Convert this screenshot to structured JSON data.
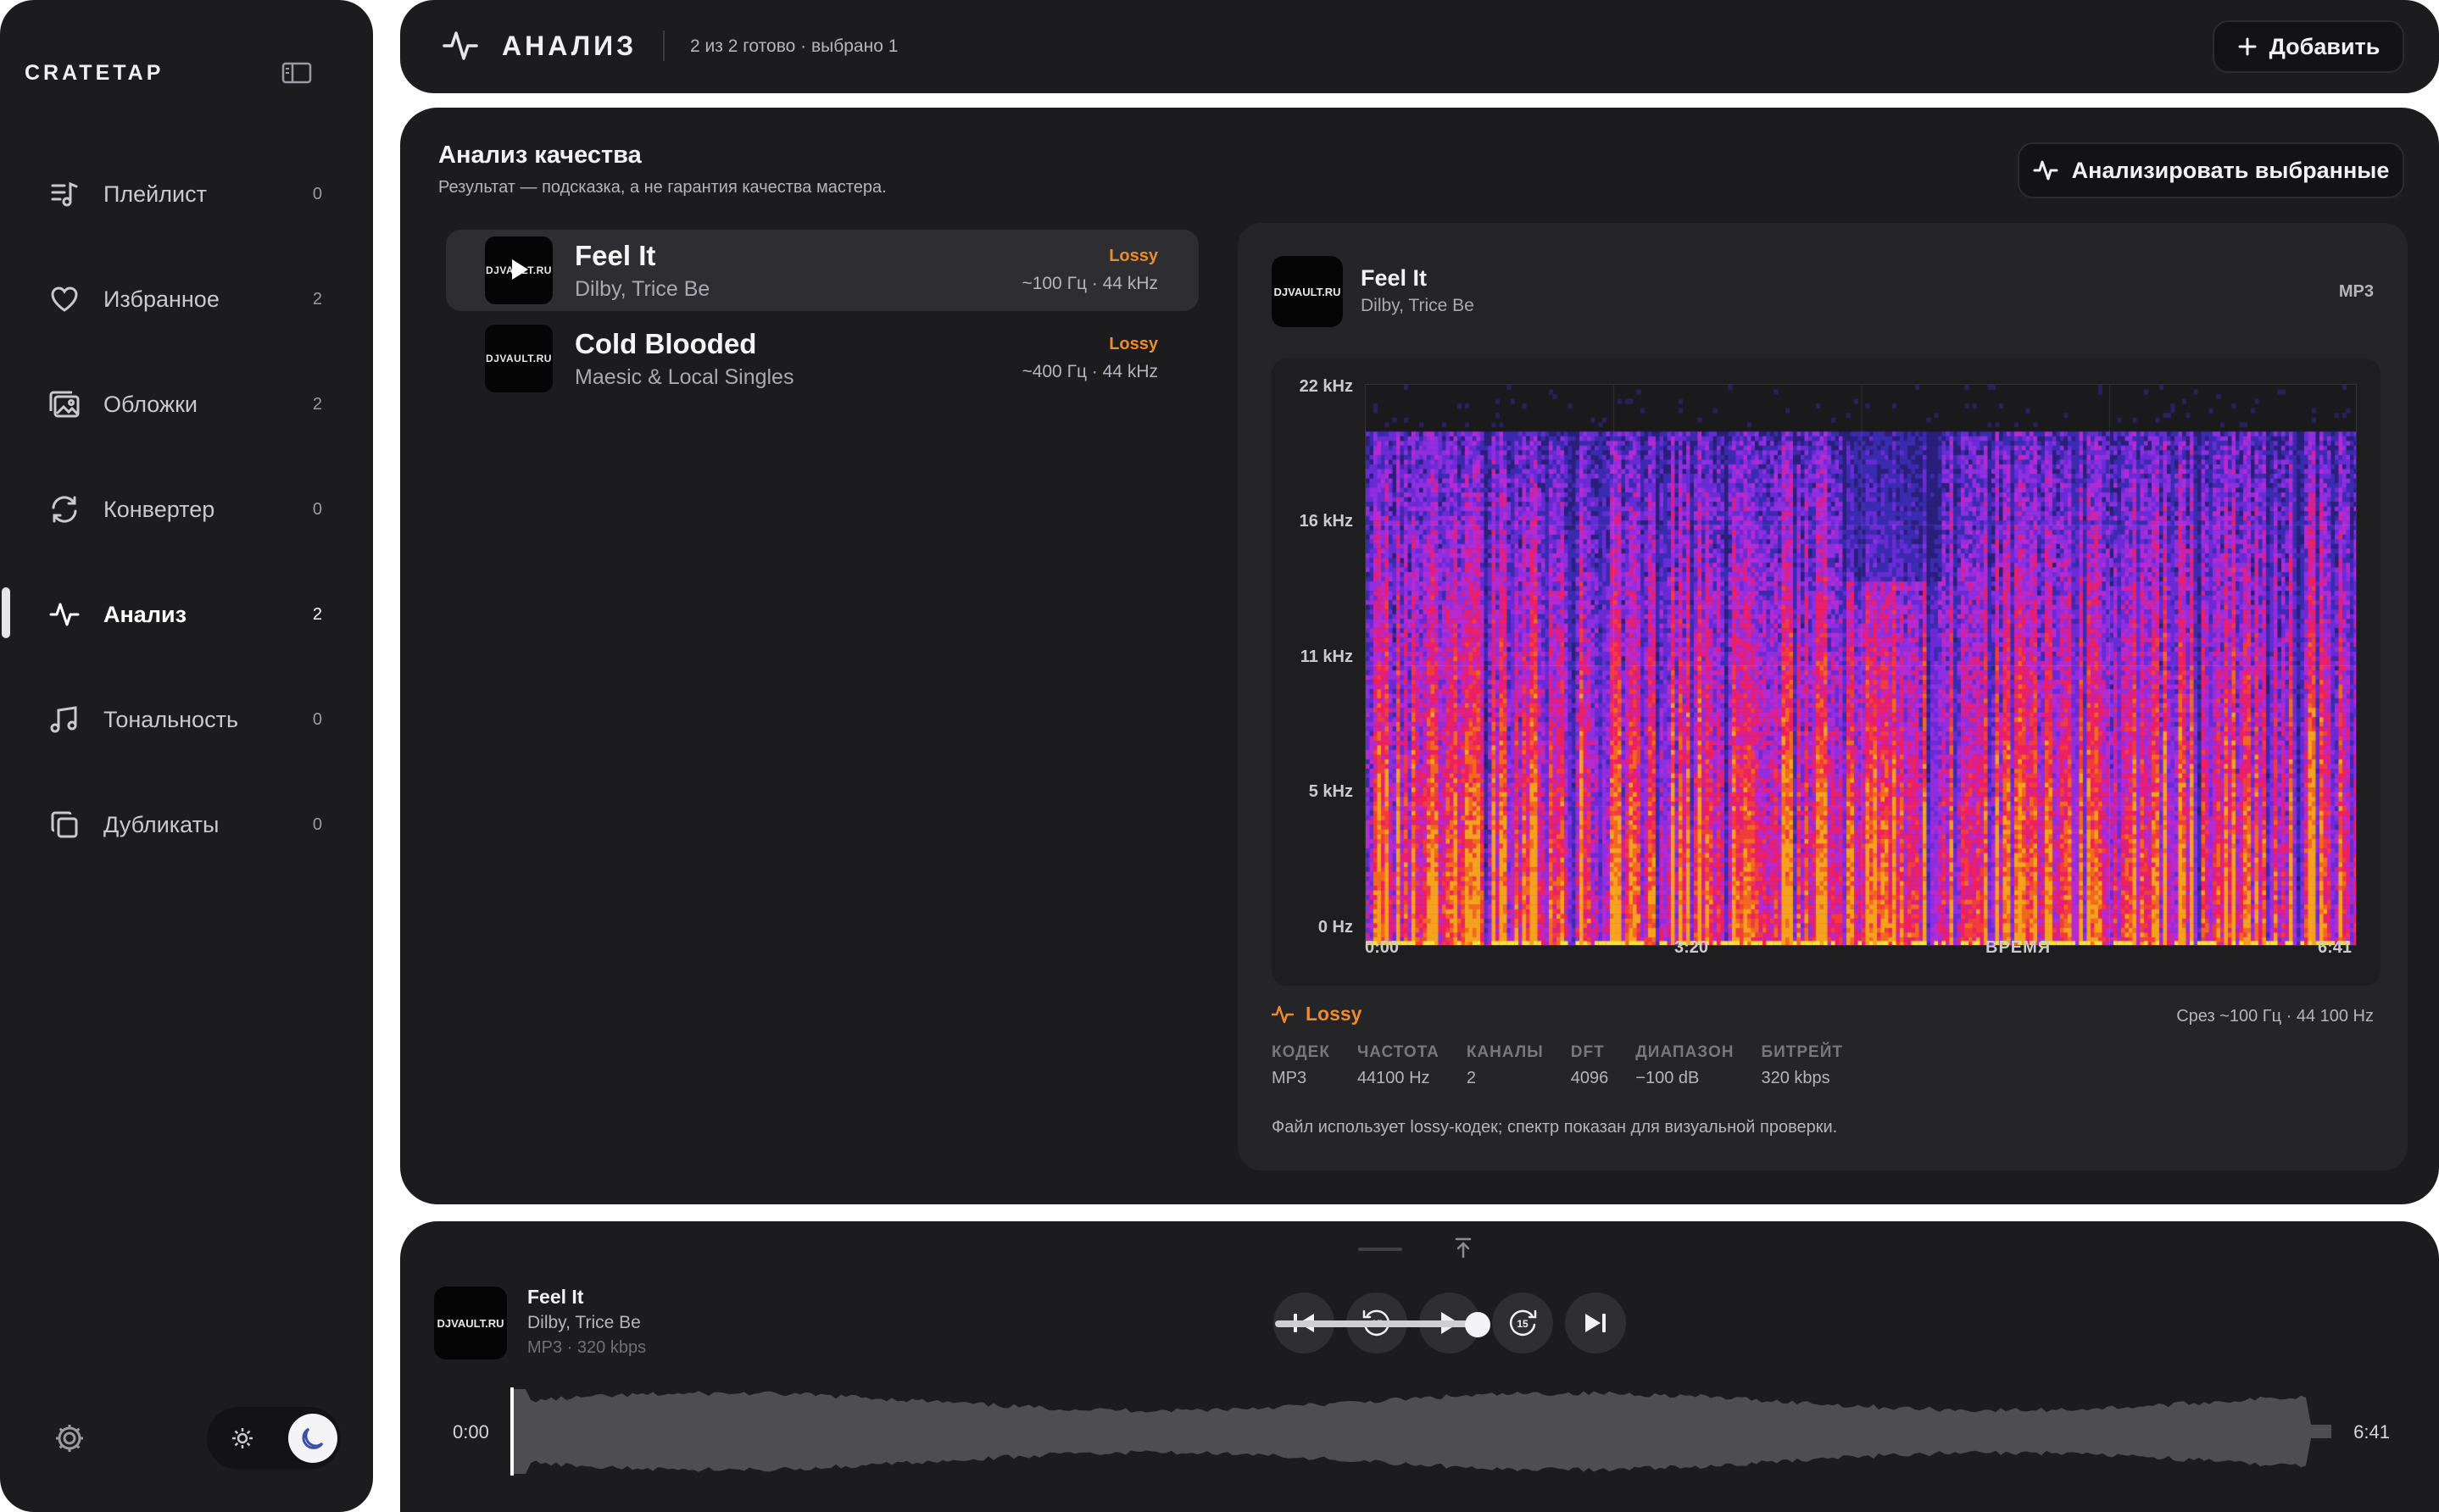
{
  "sidebar": {
    "brand": "CRATETAP",
    "nav": [
      {
        "label": "Плейлист",
        "count": "0",
        "icon": "playlist-icon"
      },
      {
        "label": "Избранное",
        "count": "2",
        "icon": "heart-icon"
      },
      {
        "label": "Обложки",
        "count": "2",
        "icon": "images-icon"
      },
      {
        "label": "Конвертер",
        "count": "0",
        "icon": "convert-icon"
      },
      {
        "label": "Анализ",
        "count": "2",
        "icon": "pulse-icon",
        "active": true
      },
      {
        "label": "Тональность",
        "count": "0",
        "icon": "music-notes-icon"
      },
      {
        "label": "Дубликаты",
        "count": "0",
        "icon": "copy-icon"
      }
    ],
    "theme": "dark"
  },
  "header": {
    "title": "АНАЛИЗ",
    "status": "2 из 2 готово · выбрано 1",
    "add_label": "Добавить"
  },
  "main": {
    "title": "Анализ качества",
    "subtitle": "Результат — подсказка, а не гарантия качества мастера.",
    "analyze_label": "Анализировать выбранные",
    "tracks": [
      {
        "name": "Feel It",
        "artist": "Dilby, Trice Be",
        "badge": "Lossy",
        "meta": "~100 Гц · 44 kHz",
        "cover": "DJVAULT.RU",
        "selected": true
      },
      {
        "name": "Cold Blooded",
        "artist": "Maesic & Local Singles",
        "badge": "Lossy",
        "meta": "~400 Гц · 44 kHz",
        "cover": "DJVAULT.RU",
        "selected": false
      }
    ]
  },
  "analysis": {
    "cover": "DJVAULT.RU",
    "title": "Feel It",
    "artist": "Dilby, Trice Be",
    "format": "MP3",
    "y_labels": [
      "22 kHz",
      "16 kHz",
      "11 kHz",
      "5 kHz",
      "0 Hz"
    ],
    "x_labels": {
      "start": "0:00",
      "mid": "3:20",
      "axis": "ВРЕМЯ",
      "end": "6:41"
    },
    "verdict": "Lossy",
    "cut_info": "Срез ~100 Гц · 44 100 Hz",
    "stats": [
      {
        "k": "КОДЕК",
        "v": "MP3"
      },
      {
        "k": "ЧАСТОТА",
        "v": "44100 Hz"
      },
      {
        "k": "КАНАЛЫ",
        "v": "2"
      },
      {
        "k": "DFT",
        "v": "4096"
      },
      {
        "k": "ДИАПАЗОН",
        "v": "−100 dB"
      },
      {
        "k": "БИТРЕЙТ",
        "v": "320 kbps"
      }
    ],
    "note": "Файл использует lossy-кодек; спектр показан для визуальной проверки.",
    "colors": {
      "accent": "#f08a2b"
    }
  },
  "player": {
    "cover": "DJVAULT.RU",
    "title": "Feel It",
    "artist": "Dilby, Trice Be",
    "meta": "MP3 · 320 kbps",
    "skip_back_seconds": "15",
    "skip_forward_seconds": "15",
    "position": "0:00",
    "duration": "6:41",
    "volume": 0.95
  }
}
